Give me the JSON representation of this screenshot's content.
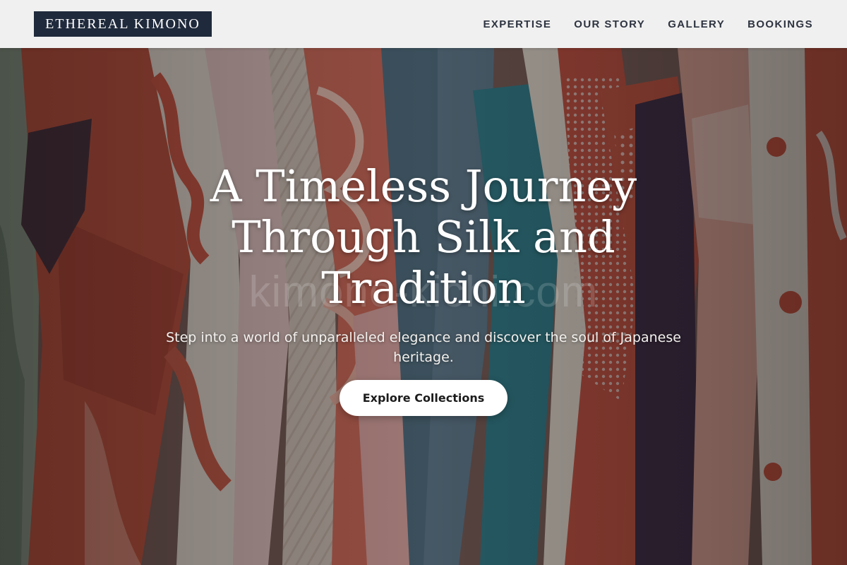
{
  "header": {
    "logo": "ETHEREAL KIMONO",
    "nav": [
      {
        "label": "EXPERTISE"
      },
      {
        "label": "OUR STORY"
      },
      {
        "label": "GALLERY"
      },
      {
        "label": "BOOKINGS"
      }
    ]
  },
  "hero": {
    "title": "A Timeless Journey Through Silk and Tradition",
    "subtitle": "Step into a world of unparalleled elegance and discover the soul of Japanese heritage.",
    "cta_label": "Explore Collections",
    "watermark": "kimono-kichi.com"
  },
  "colors": {
    "logo_bg": "#1f2a3c",
    "header_bg": "#f0f0f0",
    "nav_text": "#2d3340",
    "cta_bg": "#ffffff"
  }
}
